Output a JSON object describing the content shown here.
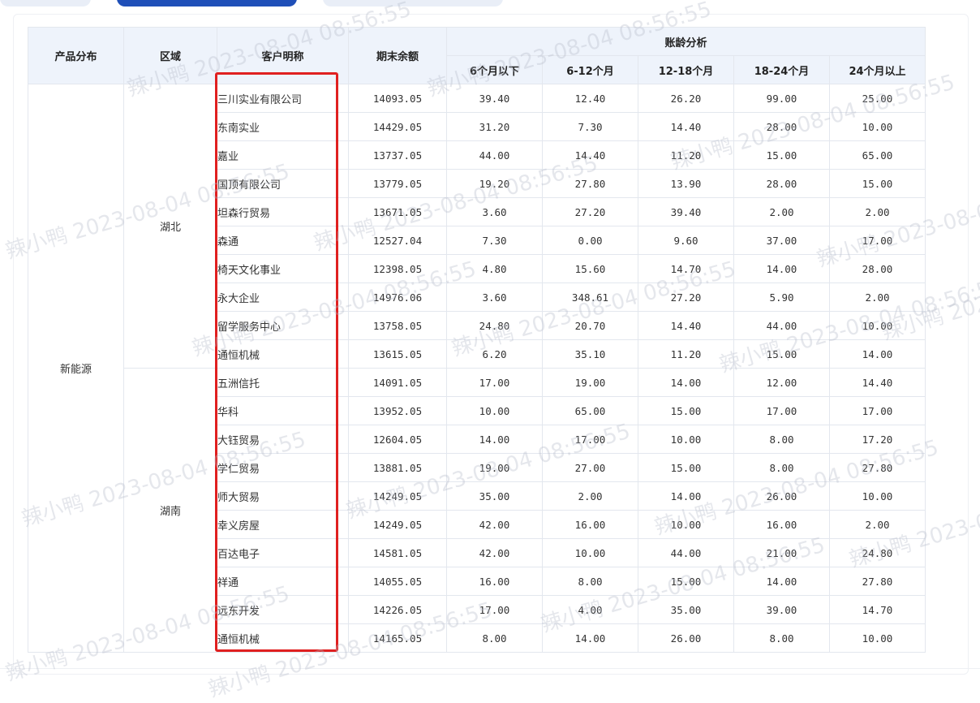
{
  "table": {
    "headers": {
      "product": "产品分布",
      "region": "区域",
      "customer": "客户明称",
      "balance": "期末余额",
      "aging_group": "账龄分析",
      "aging": [
        "6个月以下",
        "6-12个月",
        "12-18个月",
        "18-24个月",
        "24个月以上"
      ]
    },
    "product": "新能源",
    "regions": [
      "湖北",
      "湖南"
    ],
    "rows": [
      {
        "name": "三川实业有限公司",
        "balance": "14093.05",
        "a": [
          "39.40",
          "12.40",
          "26.20",
          "99.00",
          "25.00"
        ]
      },
      {
        "name": "东南实业",
        "balance": "14429.05",
        "a": [
          "31.20",
          "7.30",
          "14.40",
          "28.00",
          "10.00"
        ]
      },
      {
        "name": "嘉业",
        "balance": "13737.05",
        "a": [
          "44.00",
          "14.40",
          "11.20",
          "15.00",
          "65.00"
        ]
      },
      {
        "name": "国顶有限公司",
        "balance": "13779.05",
        "a": [
          "19.20",
          "27.80",
          "13.90",
          "28.00",
          "15.00"
        ]
      },
      {
        "name": "坦森行贸易",
        "balance": "13671.05",
        "a": [
          "3.60",
          "27.20",
          "39.40",
          "2.00",
          "2.00"
        ]
      },
      {
        "name": "森通",
        "balance": "12527.04",
        "a": [
          "7.30",
          "0.00",
          "9.60",
          "37.00",
          "17.00"
        ]
      },
      {
        "name": "椅天文化事业",
        "balance": "12398.05",
        "a": [
          "4.80",
          "15.60",
          "14.70",
          "14.00",
          "28.00"
        ]
      },
      {
        "name": "永大企业",
        "balance": "14976.06",
        "a": [
          "3.60",
          "348.61",
          "27.20",
          "5.90",
          "2.00"
        ]
      },
      {
        "name": "留学服务中心",
        "balance": "13758.05",
        "a": [
          "24.80",
          "20.70",
          "14.40",
          "44.00",
          "10.00"
        ]
      },
      {
        "name": "通恒机械",
        "balance": "13615.05",
        "a": [
          "6.20",
          "35.10",
          "11.20",
          "15.00",
          "14.00"
        ]
      },
      {
        "name": "五洲信托",
        "balance": "14091.05",
        "a": [
          "17.00",
          "19.00",
          "14.00",
          "12.00",
          "14.40"
        ]
      },
      {
        "name": "华科",
        "balance": "13952.05",
        "a": [
          "10.00",
          "65.00",
          "15.00",
          "17.00",
          "17.00"
        ]
      },
      {
        "name": "大钰贸易",
        "balance": "12604.05",
        "a": [
          "14.00",
          "17.00",
          "10.00",
          "8.00",
          "17.20"
        ]
      },
      {
        "name": "学仁贸易",
        "balance": "13881.05",
        "a": [
          "19.00",
          "27.00",
          "15.00",
          "8.00",
          "27.80"
        ]
      },
      {
        "name": "师大贸易",
        "balance": "14249.05",
        "a": [
          "35.00",
          "2.00",
          "14.00",
          "26.00",
          "10.00"
        ]
      },
      {
        "name": "幸义房屋",
        "balance": "14249.05",
        "a": [
          "42.00",
          "16.00",
          "10.00",
          "16.00",
          "2.00"
        ]
      },
      {
        "name": "百达电子",
        "balance": "14581.05",
        "a": [
          "42.00",
          "10.00",
          "44.00",
          "21.00",
          "24.80"
        ]
      },
      {
        "name": "祥通",
        "balance": "14055.05",
        "a": [
          "16.00",
          "8.00",
          "15.00",
          "14.00",
          "27.80"
        ]
      },
      {
        "name": "远东开发",
        "balance": "14226.05",
        "a": [
          "17.00",
          "4.00",
          "35.00",
          "39.00",
          "14.70"
        ]
      },
      {
        "name": "通恒机械",
        "balance": "14165.05",
        "a": [
          "8.00",
          "14.00",
          "26.00",
          "8.00",
          "10.00"
        ]
      }
    ]
  },
  "watermark": {
    "user": "辣小鸭",
    "timestamp": "2023-08-04 08:56:55"
  },
  "colors": {
    "header_bg": "#eef3fb",
    "aging_text": "#4a7fd8",
    "highlight_border": "#e02020",
    "active_tab": "#1f4fb8"
  }
}
